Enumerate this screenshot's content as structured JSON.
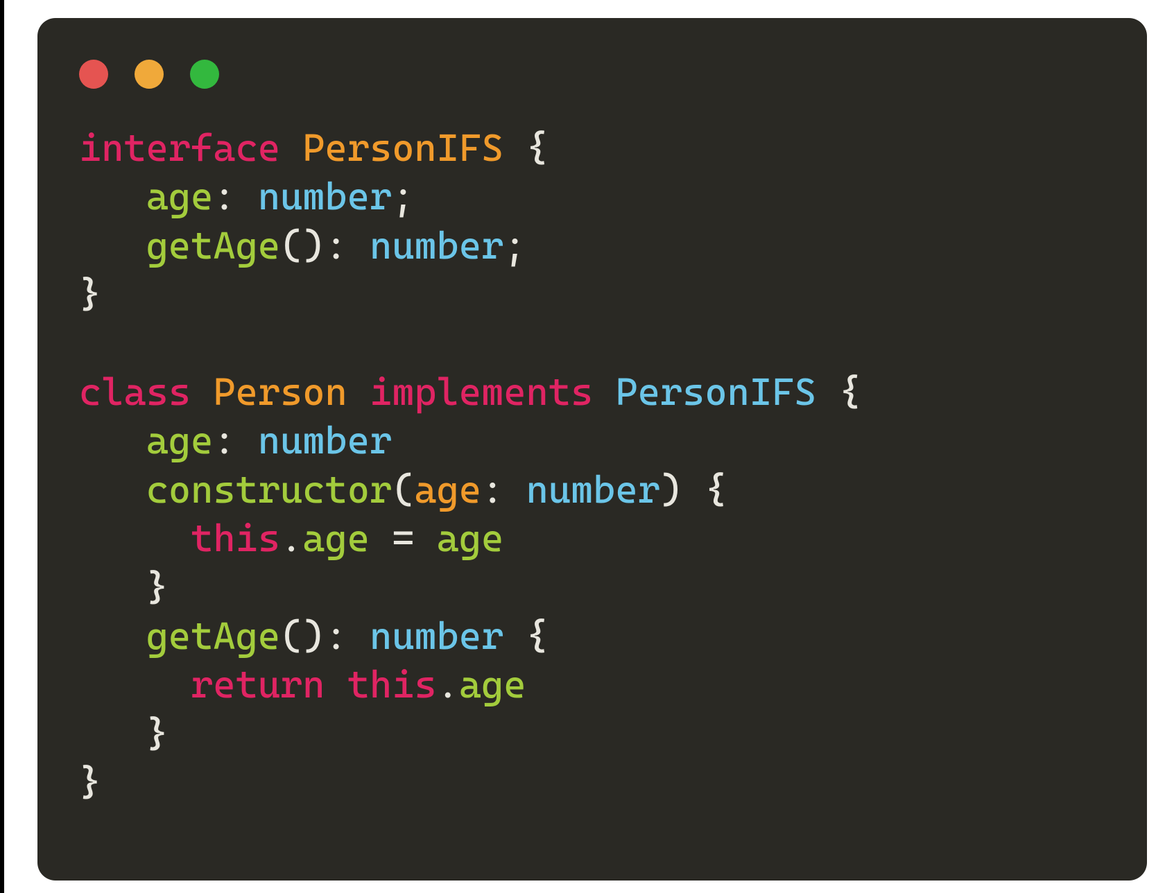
{
  "colors": {
    "window_bg": "#2a2924",
    "red": "#e55451",
    "yellow": "#f0a93a",
    "green": "#33b83e",
    "keyword": "#e02463",
    "type": "#6bc5e8",
    "name": "#f09a2b",
    "prop": "#a3cc3c",
    "default": "#e8e6de"
  },
  "tokens": {
    "kw_interface": "interface",
    "kw_class": "class",
    "kw_implements": "implements",
    "kw_this_1": "this",
    "kw_this_2": "this",
    "kw_return": "return",
    "name_PersonIFS_decl": "PersonIFS",
    "name_Person_decl": "Person",
    "type_PersonIFS_ref": "PersonIFS",
    "type_number_1": "number",
    "type_number_2": "number",
    "type_number_3": "number",
    "type_number_4": "number",
    "type_number_5": "number",
    "prop_age_if": "age",
    "prop_getAge_if": "getAge",
    "prop_age_cls": "age",
    "prop_constructor": "constructor",
    "param_age": "age",
    "prop_age_assign_l": "age",
    "prop_age_assign_r": "age",
    "prop_getAge_cls": "getAge",
    "prop_age_ret": "age",
    "p_open_brace_1": " {",
    "p_colon_sp": ": ",
    "p_semicolon": ";",
    "p_paren_open": "(",
    "p_paren_close_colon_sp": "): ",
    "p_paren_close_sp_brace": ") {",
    "p_close_brace": "}",
    "p_dot": ".",
    "p_eq": " = ",
    "p_space": " ",
    "p_indent1": "   ",
    "p_indent2": "     ",
    "p_sp_open_brace": " {"
  },
  "code_plain": "interface PersonIFS {\n   age: number;\n   getAge(): number;\n}\n\nclass Person implements PersonIFS {\n   age: number\n   constructor(age: number) {\n     this.age = age\n   }\n   getAge(): number {\n     return this.age\n   }\n}"
}
